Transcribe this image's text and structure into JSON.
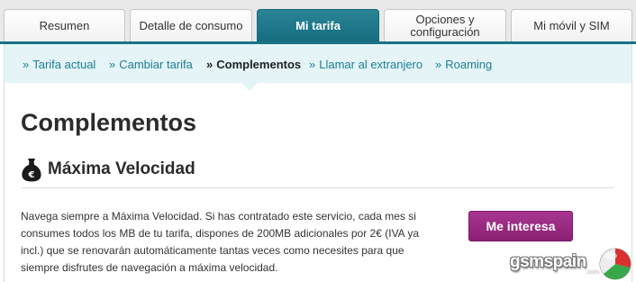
{
  "tabs": [
    {
      "label": "Resumen",
      "active": false
    },
    {
      "label": "Detalle de consumo",
      "active": false
    },
    {
      "label": "Mi tarifa",
      "active": true
    },
    {
      "label": "Opciones y configuración",
      "active": false
    },
    {
      "label": "Mi móvil y SIM",
      "active": false
    }
  ],
  "subnav": {
    "chevron": "»",
    "items": [
      {
        "label": "Tarifa actual",
        "current": false
      },
      {
        "label": "Cambiar tarifa",
        "current": false
      },
      {
        "label": "Complementos",
        "current": true
      },
      {
        "label": "Llamar al extranjero",
        "current": false
      },
      {
        "label": "Roaming",
        "current": false
      }
    ]
  },
  "page": {
    "title": "Complementos"
  },
  "section": {
    "icon": "money-bag-euro-icon",
    "icon_symbol": "€",
    "title": "Máxima Velocidad",
    "description": "Navega siempre a Máxima Velocidad. Si has contratado este servicio, cada mes si consumes todos los MB de tu tarifa, dispones de 200MB adicionales por 2€ (IVA ya incl.) que se renovarán automáticamente tantas veces como necesites para que siempre disfrutes de navegación a máxima velocidad.",
    "cta_label": "Me interesa"
  },
  "watermark": {
    "text": "gsmspain",
    "suffix": ".com"
  },
  "colors": {
    "tab_active": "#1a7386",
    "subnav_bg": "#e4f4f7",
    "link": "#1e7e91",
    "cta": "#9a2a82"
  }
}
